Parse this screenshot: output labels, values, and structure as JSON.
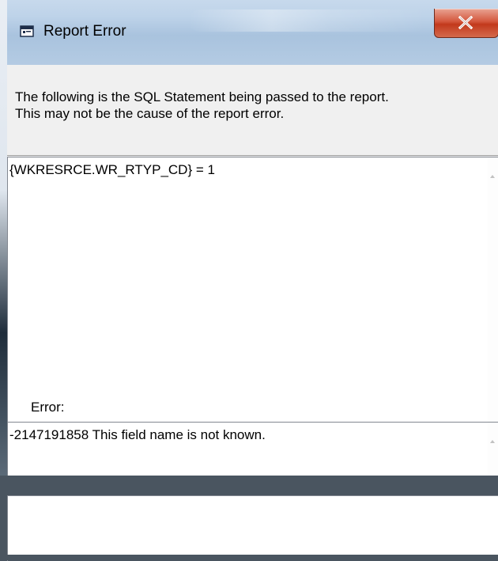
{
  "window": {
    "title": "Report Error",
    "close_symbol": "X"
  },
  "message": {
    "line1": "The following is the SQL Statement being passed to the report.",
    "line2": "This may not be the cause of the report error."
  },
  "sql_statement": "{WKRESRCE.WR_RTYP_CD} = 1",
  "error": {
    "label": "Error:",
    "text": "-2147191858 This field name is not known."
  },
  "icons": {
    "app": "report-window-icon",
    "close": "close-icon"
  },
  "colors": {
    "close_button": "#c9442a",
    "titlebar": "#b9cfe6"
  }
}
